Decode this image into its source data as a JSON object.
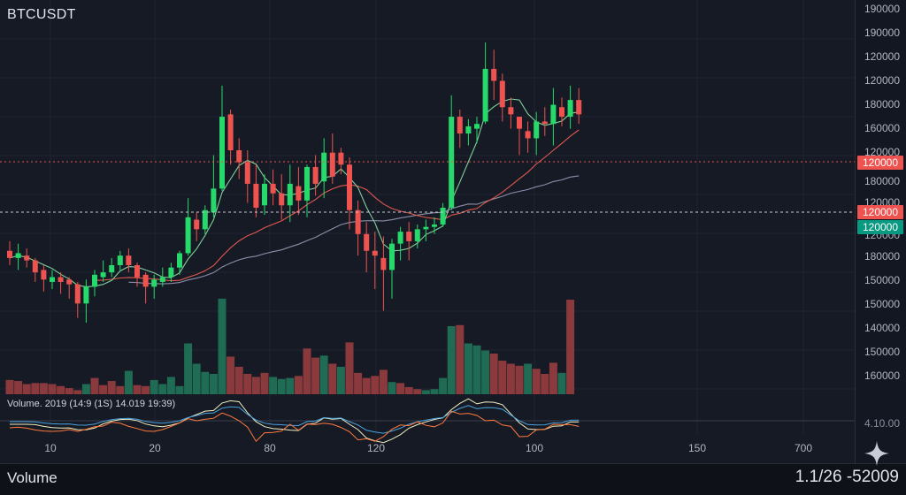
{
  "header": {
    "symbol": "BTCUSDT"
  },
  "price_scale": {
    "labels": [
      "190000",
      "190000",
      "120000",
      "120000",
      "180000",
      "160000",
      "120000",
      "180000",
      "120000",
      "120000",
      "180000",
      "150000",
      "150000",
      "140000",
      "150000",
      "160000"
    ],
    "tags": [
      {
        "text": "120000",
        "color": "#ef5350"
      },
      {
        "text": "120000",
        "color": "#ef5350"
      },
      {
        "text": "120000",
        "color": "#089981"
      }
    ],
    "indicator_label": "4.10.00"
  },
  "volume_pane": {
    "legend": "Volume. 2019 (14:9 (1S) 14.019 19:39)"
  },
  "time_axis": {
    "labels": [
      "10",
      "20",
      "80",
      "120",
      "100",
      "150",
      "700"
    ]
  },
  "footer": {
    "left": "Volume",
    "right": "1.1/26 -52009"
  },
  "colors": {
    "up": "#26d96a",
    "down": "#ef5350",
    "vol_up": "#1f6b54",
    "vol_down": "#8a3a3d",
    "ma_fast": "#7fd19a",
    "ma_mid": "#e0584f",
    "ma_slow": "#8a8fa8",
    "osc_a": "#f2f0c2",
    "osc_b": "#4aa3df",
    "osc_c": "#ff7a3d"
  },
  "chart_data": {
    "type": "candlestick",
    "candles": [
      [
        0.3,
        0.27,
        0.34,
        0.24
      ],
      [
        0.27,
        0.29,
        0.33,
        0.22
      ],
      [
        0.28,
        0.26,
        0.31,
        0.23
      ],
      [
        0.26,
        0.21,
        0.27,
        0.17
      ],
      [
        0.22,
        0.18,
        0.24,
        0.13
      ],
      [
        0.17,
        0.19,
        0.22,
        0.14
      ],
      [
        0.19,
        0.17,
        0.21,
        0.12
      ],
      [
        0.18,
        0.16,
        0.19,
        0.1
      ],
      [
        0.16,
        0.08,
        0.17,
        0.02
      ],
      [
        0.08,
        0.15,
        0.18,
        0.0
      ],
      [
        0.15,
        0.2,
        0.22,
        0.11
      ],
      [
        0.19,
        0.21,
        0.26,
        0.17
      ],
      [
        0.21,
        0.24,
        0.27,
        0.19
      ],
      [
        0.24,
        0.28,
        0.3,
        0.22
      ],
      [
        0.28,
        0.24,
        0.31,
        0.21
      ],
      [
        0.24,
        0.19,
        0.25,
        0.15
      ],
      [
        0.2,
        0.15,
        0.21,
        0.08
      ],
      [
        0.15,
        0.18,
        0.2,
        0.1
      ],
      [
        0.17,
        0.19,
        0.23,
        0.15
      ],
      [
        0.19,
        0.23,
        0.25,
        0.17
      ],
      [
        0.23,
        0.29,
        0.3,
        0.2
      ],
      [
        0.29,
        0.44,
        0.52,
        0.28
      ],
      [
        0.43,
        0.39,
        0.46,
        0.34
      ],
      [
        0.39,
        0.47,
        0.49,
        0.37
      ],
      [
        0.46,
        0.56,
        0.7,
        0.44
      ],
      [
        0.56,
        0.86,
        0.99,
        0.55
      ],
      [
        0.87,
        0.72,
        0.89,
        0.66
      ],
      [
        0.72,
        0.67,
        0.77,
        0.6
      ],
      [
        0.67,
        0.58,
        0.72,
        0.5
      ],
      [
        0.58,
        0.48,
        0.66,
        0.44
      ],
      [
        0.49,
        0.58,
        0.62,
        0.45
      ],
      [
        0.58,
        0.54,
        0.64,
        0.49
      ],
      [
        0.54,
        0.49,
        0.62,
        0.43
      ],
      [
        0.49,
        0.58,
        0.66,
        0.42
      ],
      [
        0.57,
        0.51,
        0.65,
        0.45
      ],
      [
        0.51,
        0.65,
        0.66,
        0.44
      ],
      [
        0.65,
        0.58,
        0.7,
        0.53
      ],
      [
        0.59,
        0.71,
        0.77,
        0.52
      ],
      [
        0.71,
        0.61,
        0.79,
        0.58
      ],
      [
        0.71,
        0.66,
        0.73,
        0.62
      ],
      [
        0.66,
        0.47,
        0.69,
        0.39
      ],
      [
        0.47,
        0.37,
        0.51,
        0.28
      ],
      [
        0.37,
        0.3,
        0.42,
        0.21
      ],
      [
        0.3,
        0.28,
        0.38,
        0.14
      ],
      [
        0.27,
        0.22,
        0.36,
        0.05
      ],
      [
        0.22,
        0.33,
        0.35,
        0.1
      ],
      [
        0.33,
        0.38,
        0.4,
        0.26
      ],
      [
        0.38,
        0.34,
        0.42,
        0.26
      ],
      [
        0.34,
        0.39,
        0.41,
        0.31
      ],
      [
        0.39,
        0.4,
        0.43,
        0.34
      ],
      [
        0.4,
        0.41,
        0.44,
        0.37
      ],
      [
        0.41,
        0.48,
        0.5,
        0.4
      ],
      [
        0.48,
        0.86,
        0.95,
        0.47
      ],
      [
        0.86,
        0.79,
        0.89,
        0.73
      ],
      [
        0.79,
        0.82,
        0.85,
        0.74
      ],
      [
        0.81,
        0.83,
        0.86,
        0.75
      ],
      [
        0.84,
        1.06,
        1.17,
        0.83
      ],
      [
        1.06,
        1.01,
        1.14,
        0.93
      ],
      [
        1.01,
        0.9,
        1.04,
        0.84
      ],
      [
        0.9,
        0.87,
        0.94,
        0.81
      ],
      [
        0.86,
        0.81,
        0.84,
        0.7
      ],
      [
        0.8,
        0.77,
        0.84,
        0.71
      ],
      [
        0.77,
        0.84,
        0.88,
        0.7
      ],
      [
        0.84,
        0.83,
        0.9,
        0.78
      ],
      [
        0.83,
        0.91,
        0.98,
        0.74
      ],
      [
        0.9,
        0.86,
        0.94,
        0.82
      ],
      [
        0.86,
        0.93,
        0.99,
        0.81
      ],
      [
        0.93,
        0.87,
        0.98,
        0.83
      ]
    ],
    "volume": [
      [
        14,
        "down"
      ],
      [
        13,
        "down"
      ],
      [
        10,
        "down"
      ],
      [
        11,
        "down"
      ],
      [
        11,
        "down"
      ],
      [
        10,
        "down"
      ],
      [
        8,
        "down"
      ],
      [
        6,
        "down"
      ],
      [
        4,
        "down"
      ],
      [
        10,
        "up"
      ],
      [
        16,
        "down"
      ],
      [
        9,
        "down"
      ],
      [
        13,
        "down"
      ],
      [
        8,
        "down"
      ],
      [
        23,
        "up"
      ],
      [
        9,
        "down"
      ],
      [
        8,
        "down"
      ],
      [
        14,
        "up"
      ],
      [
        10,
        "up"
      ],
      [
        17,
        "up"
      ],
      [
        8,
        "up"
      ],
      [
        50,
        "up"
      ],
      [
        30,
        "up"
      ],
      [
        22,
        "up"
      ],
      [
        20,
        "up"
      ],
      [
        94,
        "up"
      ],
      [
        37,
        "down"
      ],
      [
        27,
        "down"
      ],
      [
        20,
        "down"
      ],
      [
        17,
        "down"
      ],
      [
        21,
        "down"
      ],
      [
        17,
        "up"
      ],
      [
        15,
        "up"
      ],
      [
        16,
        "up"
      ],
      [
        18,
        "down"
      ],
      [
        45,
        "down"
      ],
      [
        36,
        "down"
      ],
      [
        38,
        "up"
      ],
      [
        30,
        "down"
      ],
      [
        27,
        "up"
      ],
      [
        51,
        "down"
      ],
      [
        21,
        "down"
      ],
      [
        16,
        "down"
      ],
      [
        18,
        "down"
      ],
      [
        24,
        "down"
      ],
      [
        12,
        "up"
      ],
      [
        11,
        "down"
      ],
      [
        7,
        "down"
      ],
      [
        5,
        "down"
      ],
      [
        4,
        "up"
      ],
      [
        5,
        "up"
      ],
      [
        16,
        "up"
      ],
      [
        67,
        "up"
      ],
      [
        68,
        "down"
      ],
      [
        50,
        "up"
      ],
      [
        48,
        "up"
      ],
      [
        43,
        "up"
      ],
      [
        40,
        "down"
      ],
      [
        33,
        "down"
      ],
      [
        30,
        "down"
      ],
      [
        28,
        "down"
      ],
      [
        30,
        "up"
      ],
      [
        25,
        "down"
      ],
      [
        20,
        "down"
      ],
      [
        31,
        "down"
      ],
      [
        21,
        "up"
      ],
      [
        93,
        "down"
      ]
    ]
  }
}
